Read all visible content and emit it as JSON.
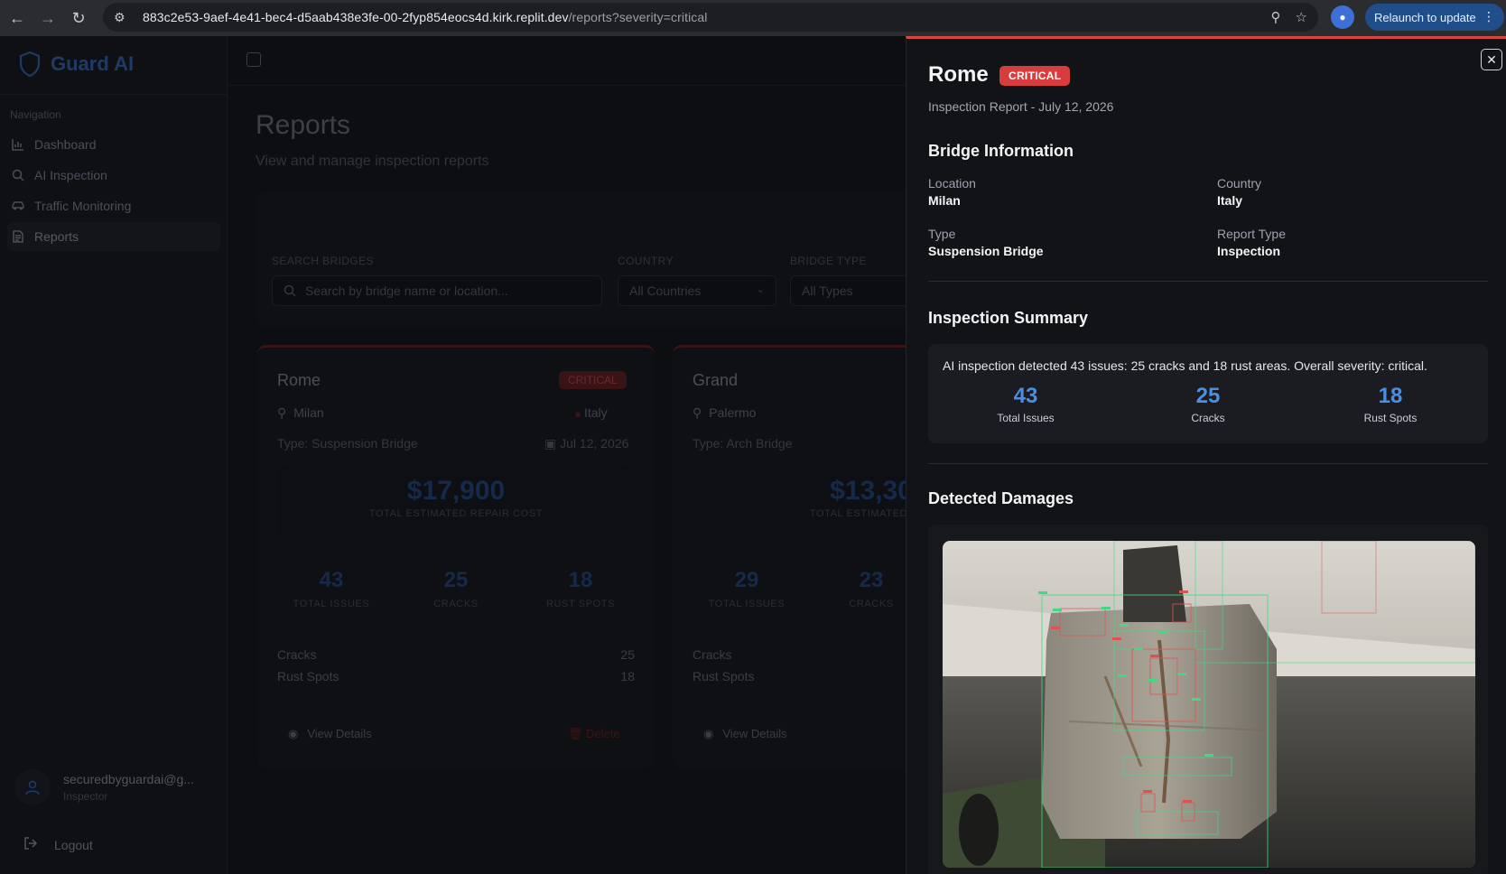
{
  "browser": {
    "url_main": "883c2e53-9aef-4e41-bec4-d5aab438e3fe-00-2fyp854eocs4d.kirk.replit.dev",
    "url_path": "/reports?severity=critical",
    "relaunch_label": "Relaunch to update"
  },
  "brand": {
    "name": "Guard AI"
  },
  "sidebar": {
    "section_label": "Navigation",
    "items": [
      {
        "label": "Dashboard",
        "icon": "bar-chart-icon"
      },
      {
        "label": "AI Inspection",
        "icon": "search-icon"
      },
      {
        "label": "Traffic Monitoring",
        "icon": "car-icon"
      },
      {
        "label": "Reports",
        "icon": "file-icon"
      }
    ],
    "user": {
      "email": "securedbyguardai@g...",
      "role": "Inspector"
    },
    "logout_label": "Logout"
  },
  "page": {
    "title": "Reports",
    "subtitle": "View and manage inspection reports"
  },
  "filters": {
    "search_label": "SEARCH BRIDGES",
    "search_placeholder": "Search by bridge name or location...",
    "country_label": "COUNTRY",
    "country_value": "All Countries",
    "type_label": "BRIDGE TYPE",
    "type_value": "All Types"
  },
  "cards": [
    {
      "name": "Rome",
      "badge": "CRITICAL",
      "location": "Milan",
      "country": "Italy",
      "type": "Type: Suspension Bridge",
      "date": "Jul 12, 2026",
      "cost": "$17,900",
      "cost_label": "TOTAL ESTIMATED REPAIR COST",
      "stats": [
        {
          "n": "43",
          "l": "TOTAL ISSUES"
        },
        {
          "n": "25",
          "l": "CRACKS"
        },
        {
          "n": "18",
          "l": "RUST SPOTS"
        }
      ],
      "rows": [
        {
          "k": "Cracks",
          "v": "25"
        },
        {
          "k": "Rust Spots",
          "v": "18"
        }
      ],
      "view_label": "View Details",
      "delete_label": "Delete"
    },
    {
      "name": "Grand",
      "location": "Palermo",
      "type": "Type: Arch Bridge",
      "cost": "$13,30",
      "cost_label": "TOTAL ESTIMATED REP",
      "stats": [
        {
          "n": "29",
          "l": "TOTAL ISSUES"
        },
        {
          "n": "23",
          "l": "CRACKS"
        }
      ],
      "rows": [
        {
          "k": "Cracks"
        },
        {
          "k": "Rust Spots"
        }
      ],
      "view_label": "View Details"
    }
  ],
  "drawer": {
    "title": "Rome",
    "badge": "CRITICAL",
    "subtitle": "Inspection Report - July 12, 2026",
    "bridge_info_heading": "Bridge Information",
    "info": [
      {
        "label": "Location",
        "value": "Milan"
      },
      {
        "label": "Country",
        "value": "Italy"
      },
      {
        "label": "Type",
        "value": "Suspension Bridge"
      },
      {
        "label": "Report Type",
        "value": "Inspection"
      }
    ],
    "summary_heading": "Inspection Summary",
    "summary_text": "AI inspection detected 43 issues: 25 cracks and 18 rust areas. Overall severity: critical.",
    "summary_stats": [
      {
        "n": "43",
        "l": "Total Issues"
      },
      {
        "n": "25",
        "l": "Cracks"
      },
      {
        "n": "18",
        "l": "Rust Spots"
      }
    ],
    "damages_heading": "Detected Damages"
  },
  "colors": {
    "accent_blue": "#4a90e2",
    "critical_red": "#d93c3c",
    "crack_box": "#3ddc84",
    "rust_box": "#e05252"
  }
}
